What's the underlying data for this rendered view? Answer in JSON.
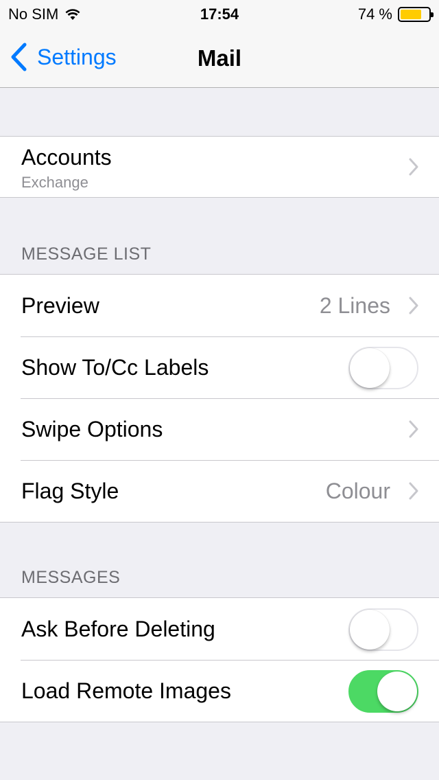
{
  "status_bar": {
    "carrier": "No SIM",
    "time": "17:54",
    "battery_text": "74 %",
    "battery_level": 0.74,
    "battery_color": "#ffcc00",
    "wifi_icon": "wifi-icon"
  },
  "nav": {
    "back_label": "Settings",
    "title": "Mail",
    "accent_color": "#007aff"
  },
  "accounts": {
    "title": "Accounts",
    "subtitle": "Exchange"
  },
  "message_list": {
    "header": "MESSAGE LIST",
    "preview": {
      "label": "Preview",
      "value": "2 Lines"
    },
    "show_to_cc": {
      "label": "Show To/Cc Labels",
      "on": false
    },
    "swipe_options": {
      "label": "Swipe Options"
    },
    "flag_style": {
      "label": "Flag Style",
      "value": "Colour"
    }
  },
  "messages": {
    "header": "MESSAGES",
    "ask_before_deleting": {
      "label": "Ask Before Deleting",
      "on": false
    },
    "load_remote_images": {
      "label": "Load Remote Images",
      "on": true
    },
    "toggle_on_color": "#4cd964"
  }
}
